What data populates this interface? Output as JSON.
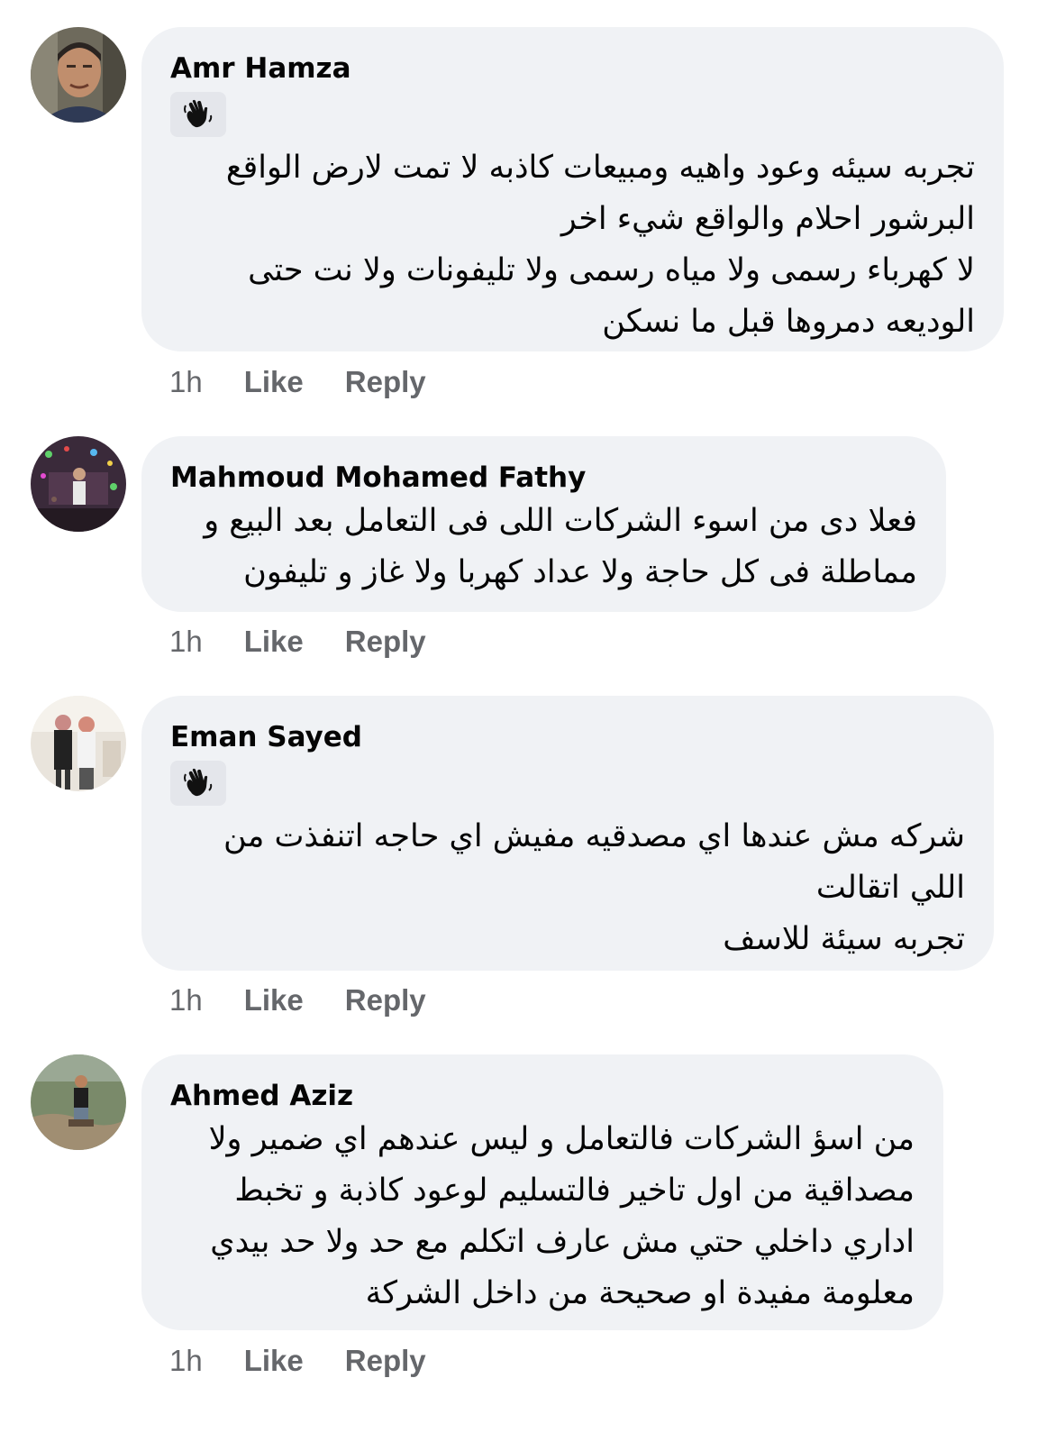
{
  "comments": [
    {
      "author": "Amr Hamza",
      "badge_icon": "waving-hand-icon",
      "lines": [
        "تجربه سيئه وعود واهيه ومبيعات كاذبه لا تمت لارض الواقع",
        "البرشور احلام والواقع شيء اخر",
        "لا كهرباء رسمى ولا مياه رسمى ولا تليفونات ولا نت  حتى",
        "الوديعه دمروها قبل ما نسكن"
      ],
      "time": "1h",
      "like_label": "Like",
      "reply_label": "Reply"
    },
    {
      "author": "Mahmoud Mohamed Fathy",
      "lines": [
        "فعلا دى من اسوء الشركات اللى فى التعامل بعد البيع و",
        "مماطلة فى كل حاجة ولا عداد كهربا ولا غاز و تليفون"
      ],
      "time": "1h",
      "like_label": "Like",
      "reply_label": "Reply"
    },
    {
      "author": "Eman Sayed",
      "badge_icon": "waving-hand-icon",
      "lines": [
        "شركه مش عندها اي مصدقيه مفيش اي حاجه اتنفذت من",
        "اللي اتقالت",
        "تجربه سيئة للاسف"
      ],
      "time": "1h",
      "like_label": "Like",
      "reply_label": "Reply"
    },
    {
      "author": "Ahmed Aziz",
      "lines": [
        "من اسؤ الشركات فالتعامل و ليس عندهم اي ضمير ولا",
        "مصداقية من اول تاخير فالتسليم لوعود كاذبة و تخبط",
        "اداري داخلي حتي مش عارف اتكلم مع حد ولا حد بيدي",
        "معلومة مفيدة او صحيحة من داخل الشركة"
      ],
      "time": "1h",
      "like_label": "Like",
      "reply_label": "Reply"
    }
  ],
  "colors": {
    "bubble_bg": "#f0f2f5",
    "text": "#050505",
    "meta": "#65676b"
  }
}
